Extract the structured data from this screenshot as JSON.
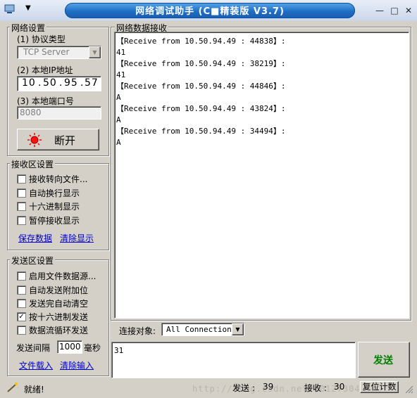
{
  "window": {
    "title": "网络调试助手 (C■精装版 V3.7)"
  },
  "network": {
    "group_title": "网络设置",
    "protocol_label": "(1) 协议类型",
    "protocol_value": "TCP Server",
    "ip_label": "(2) 本地IP地址",
    "ip_octets": [
      "10",
      "50",
      "95",
      "57"
    ],
    "port_label": "(3) 本地端口号",
    "port_value": "8080",
    "disconnect_label": "断开"
  },
  "receive_settings": {
    "group_title": "接收区设置",
    "options": [
      {
        "label": "接收转向文件...",
        "checked": false
      },
      {
        "label": "自动换行显示",
        "checked": false
      },
      {
        "label": "十六进制显示",
        "checked": false
      },
      {
        "label": "暂停接收显示",
        "checked": false
      }
    ],
    "save_link": "保存数据",
    "clear_link": "清除显示"
  },
  "send_settings": {
    "group_title": "发送区设置",
    "options": [
      {
        "label": "启用文件数据源...",
        "checked": false
      },
      {
        "label": "自动发送附加位",
        "checked": false
      },
      {
        "label": "发送完自动清空",
        "checked": false
      },
      {
        "label": "按十六进制发送",
        "checked": true
      },
      {
        "label": "数据流循环发送",
        "checked": false
      }
    ],
    "interval_label": "发送间隔",
    "interval_value": "1000",
    "interval_unit": "毫秒",
    "load_link": "文件载入",
    "clear_link": "清除输入"
  },
  "receive_area": {
    "group_title": "网络数据接收",
    "lines": [
      "【Receive from 10.50.94.49 : 44838】:",
      "41",
      "【Receive from 10.50.94.49 : 38219】:",
      "41",
      "【Receive from 10.50.94.49 : 44846】:",
      "A",
      "【Receive from 10.50.94.49 : 43824】:",
      "A",
      "【Receive from 10.50.94.49 : 34494】:",
      "A"
    ]
  },
  "connection": {
    "label": "连接对象:",
    "value": "All Connections"
  },
  "send_area": {
    "text": "31",
    "send_button": "发送"
  },
  "status": {
    "ready": "就绪!",
    "sent_label": "发送 :",
    "sent_value": "39",
    "recv_label": "接收 :",
    "recv_value": "30",
    "reset_label": "复位计数"
  },
  "watermark": "http://blog.csdn.net/u012730437"
}
